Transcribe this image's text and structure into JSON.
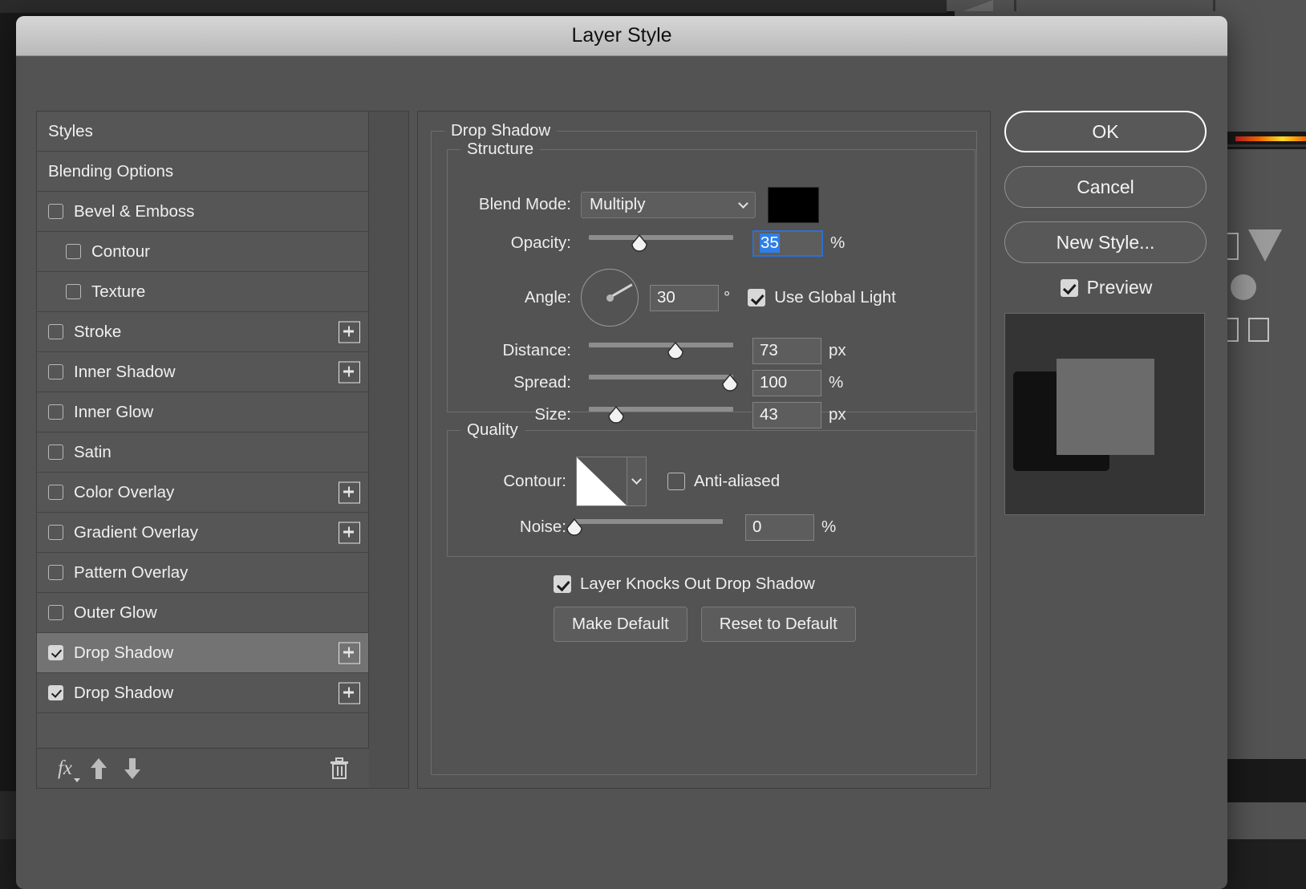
{
  "dialog": {
    "title": "Layer Style"
  },
  "styles_panel": {
    "items": [
      {
        "label": "Styles",
        "checkbox": "none",
        "indent": 0,
        "plus": false,
        "selected": false
      },
      {
        "label": "Blending Options",
        "checkbox": "none",
        "indent": 0,
        "plus": false,
        "selected": false
      },
      {
        "label": "Bevel & Emboss",
        "checkbox": "off",
        "indent": 0,
        "plus": false,
        "selected": false
      },
      {
        "label": "Contour",
        "checkbox": "off",
        "indent": 1,
        "plus": false,
        "selected": false
      },
      {
        "label": "Texture",
        "checkbox": "off",
        "indent": 1,
        "plus": false,
        "selected": false
      },
      {
        "label": "Stroke",
        "checkbox": "off",
        "indent": 0,
        "plus": true,
        "selected": false
      },
      {
        "label": "Inner Shadow",
        "checkbox": "off",
        "indent": 0,
        "plus": true,
        "selected": false
      },
      {
        "label": "Inner Glow",
        "checkbox": "off",
        "indent": 0,
        "plus": false,
        "selected": false
      },
      {
        "label": "Satin",
        "checkbox": "off",
        "indent": 0,
        "plus": false,
        "selected": false
      },
      {
        "label": "Color Overlay",
        "checkbox": "off",
        "indent": 0,
        "plus": true,
        "selected": false
      },
      {
        "label": "Gradient Overlay",
        "checkbox": "off",
        "indent": 0,
        "plus": true,
        "selected": false
      },
      {
        "label": "Pattern Overlay",
        "checkbox": "off",
        "indent": 0,
        "plus": false,
        "selected": false
      },
      {
        "label": "Outer Glow",
        "checkbox": "off",
        "indent": 0,
        "plus": false,
        "selected": false
      },
      {
        "label": "Drop Shadow",
        "checkbox": "on",
        "indent": 0,
        "plus": true,
        "selected": true
      },
      {
        "label": "Drop Shadow",
        "checkbox": "on",
        "indent": 0,
        "plus": true,
        "selected": false
      }
    ],
    "toolbar": {
      "fx_label": "fx",
      "fx_icon": "fx-icon",
      "move_up_icon": "arrow-up-icon",
      "move_down_icon": "arrow-down-icon",
      "delete_icon": "trash-icon"
    }
  },
  "settings": {
    "section_title": "Drop Shadow",
    "structure": {
      "legend": "Structure",
      "blend_mode_label": "Blend Mode:",
      "blend_mode_value": "Multiply",
      "blend_mode_options": [
        "Multiply"
      ],
      "color_swatch": "#000000",
      "opacity_label": "Opacity:",
      "opacity_value": "35",
      "opacity_unit": "%",
      "opacity_percent": 35,
      "angle_label": "Angle:",
      "angle_value": "30",
      "angle_unit": "°",
      "use_global_light_label": "Use Global Light",
      "use_global_light_checked": true,
      "distance_label": "Distance:",
      "distance_value": "73",
      "distance_unit": "px",
      "distance_percent": 60,
      "spread_label": "Spread:",
      "spread_value": "100",
      "spread_unit": "%",
      "spread_percent": 98,
      "size_label": "Size:",
      "size_value": "43",
      "size_unit": "px",
      "size_percent": 19
    },
    "quality": {
      "legend": "Quality",
      "contour_label": "Contour:",
      "contour_preset": "linear",
      "anti_aliased_label": "Anti-aliased",
      "anti_aliased_checked": false,
      "noise_label": "Noise:",
      "noise_value": "0",
      "noise_unit": "%",
      "noise_percent": 0
    },
    "knockout_label": "Layer Knocks Out Drop Shadow",
    "knockout_checked": true,
    "make_default_label": "Make Default",
    "reset_default_label": "Reset to Default"
  },
  "actions": {
    "ok_label": "OK",
    "cancel_label": "Cancel",
    "new_style_label": "New Style...",
    "preview_label": "Preview",
    "preview_checked": true
  },
  "colors": {
    "dialog_bg": "#535353",
    "titlebar_top": "#d6d6d6",
    "selection_blue": "#2f7fe8",
    "row_selected": "#737373",
    "swatch_black": "#000000"
  }
}
